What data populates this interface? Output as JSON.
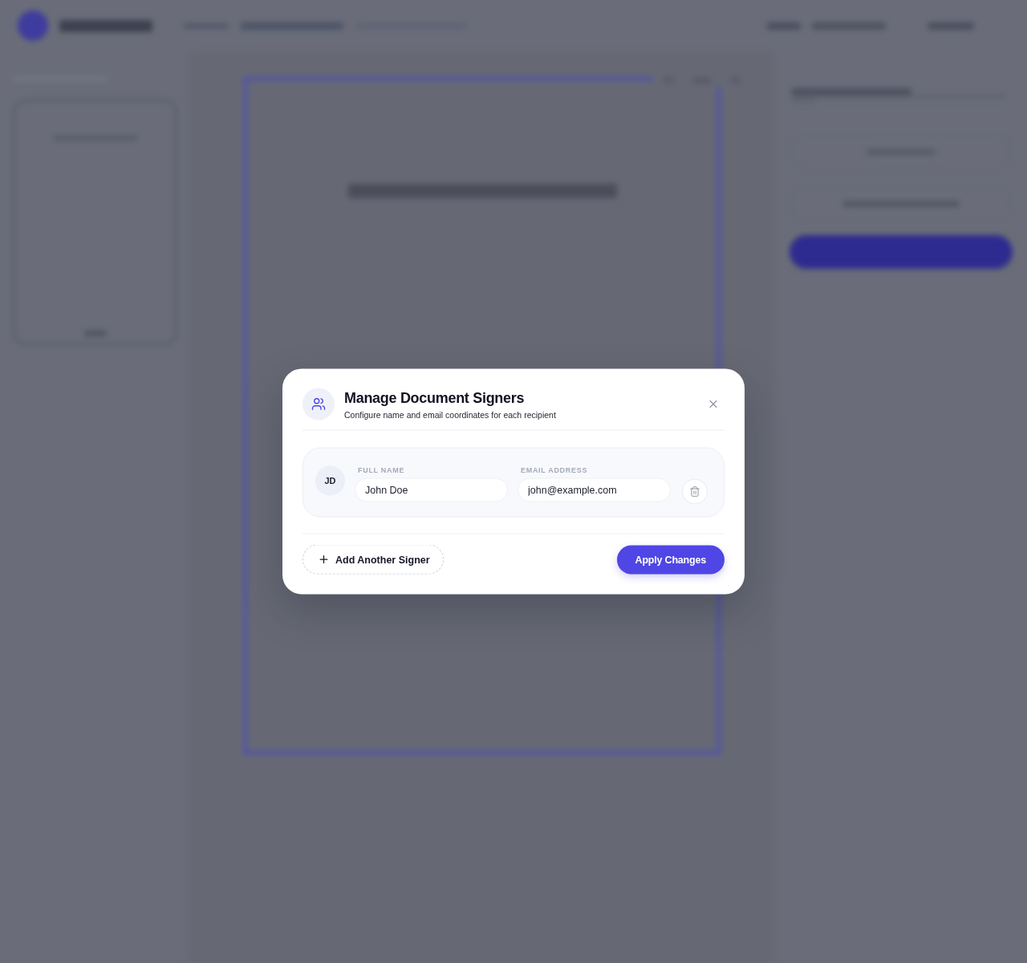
{
  "dialog": {
    "title": "Manage Document Signers",
    "subtitle": "Configure name and email coordinates for each recipient",
    "signers": [
      {
        "initials": "JD",
        "fields": [
          {
            "label": "FULL NAME",
            "value": "John Doe"
          },
          {
            "label": "EMAIL ADDRESS",
            "value": "john@example.com"
          }
        ]
      }
    ],
    "add_button": "Add Another Signer",
    "apply_button": "Apply Changes"
  }
}
